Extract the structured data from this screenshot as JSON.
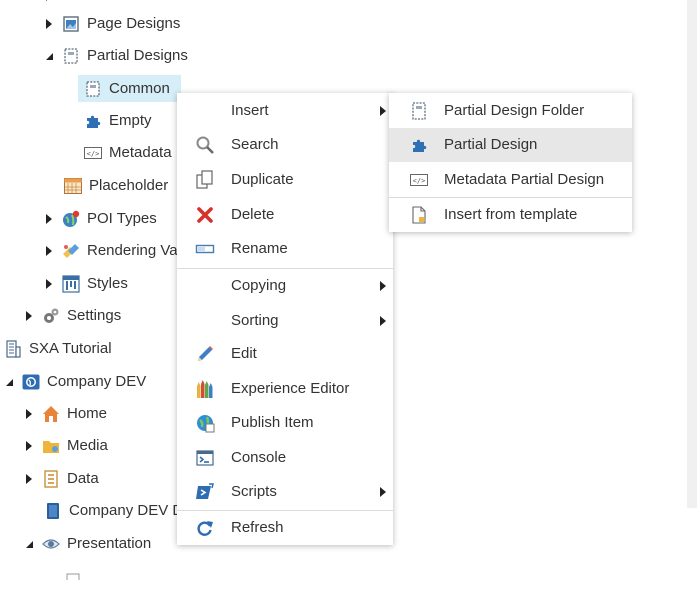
{
  "tree": {
    "page_designs": "Page Designs",
    "partial_designs": "Partial Designs",
    "common": "Common",
    "empty": "Empty",
    "metadata": "Metadata",
    "placeholder": "Placeholder",
    "poi_types": "POI Types",
    "rendering_variants": "Rendering Va",
    "styles": "Styles",
    "settings": "Settings",
    "sxa_tutorial": "SXA Tutorial",
    "company_dev": "Company DEV",
    "home": "Home",
    "media": "Media",
    "data": "Data",
    "company_dev_dictionary": "Company DEV D",
    "presentation": "Presentation"
  },
  "context_menu": {
    "insert": "Insert",
    "search": "Search",
    "duplicate": "Duplicate",
    "delete": "Delete",
    "rename": "Rename",
    "copying": "Copying",
    "sorting": "Sorting",
    "edit": "Edit",
    "experience_editor": "Experience Editor",
    "publish_item": "Publish Item",
    "console": "Console",
    "scripts": "Scripts",
    "refresh": "Refresh"
  },
  "insert_submenu": {
    "partial_design_folder": "Partial Design Folder",
    "partial_design": "Partial Design",
    "metadata_partial_design": "Metadata Partial Design",
    "insert_from_template": "Insert from template"
  },
  "colors": {
    "selection": "#d6eef8",
    "hover": "#e7e7e7",
    "text": "#333333"
  }
}
